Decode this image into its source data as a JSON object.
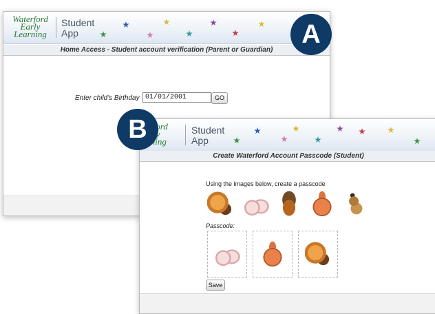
{
  "logo": {
    "line1": "Waterford",
    "line2": "Early",
    "line3": "Learning"
  },
  "app": {
    "line1": "Student",
    "line2": "App"
  },
  "windowA": {
    "title": "Home Access - Student account verification (Parent or Guardian)",
    "birthday_label": "Enter child's Birthday",
    "birthday_value": "01/01/2001",
    "go_label": "GO"
  },
  "windowB": {
    "title": "Create Waterford Account Passcode (Student)",
    "instruction": "Using the images below, create a passcode",
    "choices": [
      "squirrel-with-violin",
      "ballet-slippers",
      "acorn",
      "bag",
      "ant"
    ],
    "passcode_label": "Passcode:",
    "passcode_selected": [
      "ballet-slippers",
      "bag",
      "squirrel-with-violin"
    ],
    "save_label": "Save"
  },
  "badges": {
    "a": "A",
    "b": "B"
  },
  "colors": {
    "badge": "#0f3a66",
    "logo_green": "#2e7d3a"
  }
}
